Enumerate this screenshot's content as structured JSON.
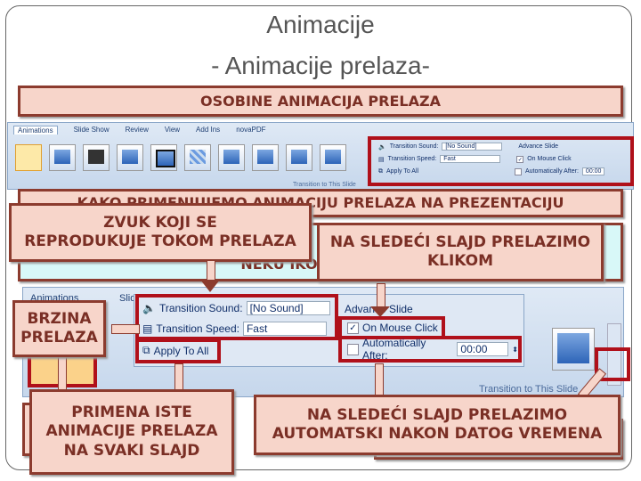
{
  "title": {
    "line1": "Animacije",
    "line2": "- Animacije prelaza-"
  },
  "boxes": {
    "osobine": "OSOBINE ANIMACIJA PRELAZA",
    "kako": "KAKO PRIMENJUJEMO ANIMACIJU PRELAZA NA PREZENTACIJU",
    "ikonu": "NEKU IKONU GRUPE",
    "zvuk1": "ZVUK KOJI SE",
    "zvuk2": "REPRODUKUJE TOKOM PRELAZA",
    "klik1": "NA SLEDEĆI SLAJD PRELAZIMO",
    "klik2": "KLIKOM",
    "brzina1": "BRZINA",
    "brzina2": "PRELAZA",
    "primena1": "PRIMENA ISTE",
    "primena2": "ANIMACIJE PRELAZA",
    "primena3": "NA SVAKI SLAJD",
    "auto1": "NA SLEDEĆI SLAJD PRELAZIMO",
    "auto2": "AUTOMATSKI NAKON DATOG VREMENA"
  },
  "ribbon": {
    "tabs": [
      "Animations",
      "Slide Show",
      "Review",
      "View",
      "Add Ins",
      "novaPDF"
    ],
    "transition_sound_label": "Transition Sound:",
    "transition_sound_value": "[No Sound]",
    "transition_speed_label": "Transition Speed:",
    "transition_speed_value": "Fast",
    "apply_to_all": "Apply To All",
    "advance_slide": "Advance Slide",
    "on_mouse_click": "On Mouse Click",
    "on_mouse_click_checked": true,
    "automatically_after": "Automatically After:",
    "automatically_after_checked": false,
    "time_value": "00:00",
    "group_label": "Transition to This Slide"
  },
  "colors": {
    "box_fill": "#f7d5ca",
    "box_border": "#8c3b2e",
    "highlight": "#b0101a",
    "cyan": "#d8f8f8"
  }
}
